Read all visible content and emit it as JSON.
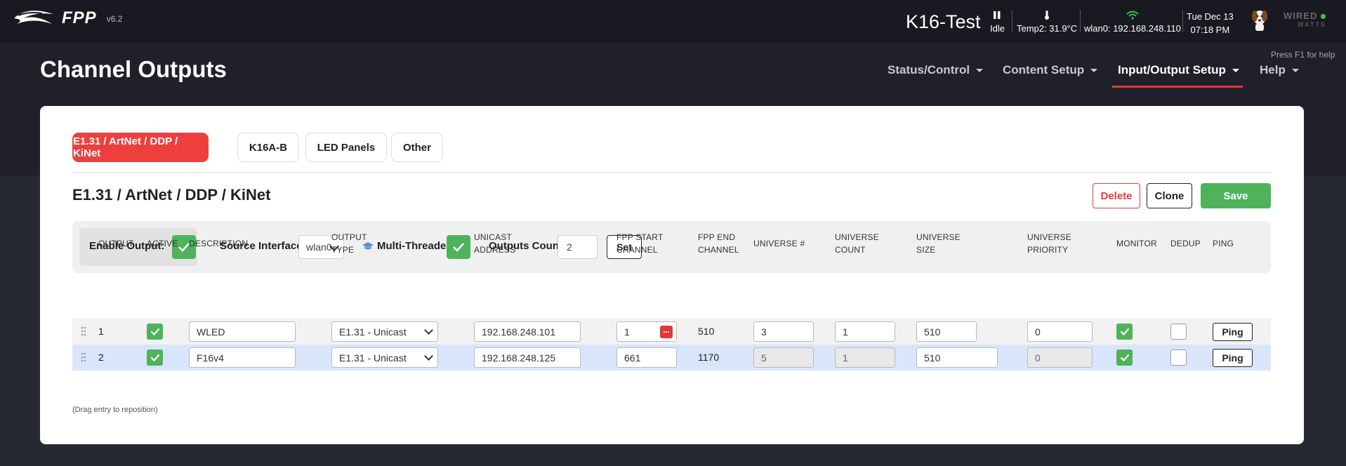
{
  "header": {
    "logo_text": "FPP",
    "version": "v6.2",
    "hostname": "K16-Test",
    "status": [
      {
        "icon": "pause-icon",
        "label": "Idle"
      },
      {
        "icon": "thermometer-icon",
        "label": "Temp2: 31.9°C"
      },
      {
        "icon": "wifi-icon",
        "label": "wlan0: 192.168.248.110"
      }
    ],
    "date": "Tue Dec 13",
    "time": "07:18 PM",
    "brand_top": "WIRED",
    "brand_bottom": "WATTS"
  },
  "page": {
    "title": "Channel Outputs",
    "help_hint": "Press F1 for help"
  },
  "nav": [
    {
      "label": "Status/Control",
      "active": false
    },
    {
      "label": "Content Setup",
      "active": false
    },
    {
      "label": "Input/Output Setup",
      "active": true
    },
    {
      "label": "Help",
      "active": false
    }
  ],
  "tabs": [
    {
      "label": "E1.31 / ArtNet / DDP / KiNet",
      "active": true
    },
    {
      "label": "K16A-B",
      "active": false
    },
    {
      "label": "LED Panels",
      "active": false
    },
    {
      "label": "Other",
      "active": false
    }
  ],
  "section": {
    "title": "E1.31 / ArtNet / DDP / KiNet",
    "delete_label": "Delete",
    "clone_label": "Clone",
    "save_label": "Save"
  },
  "settings": {
    "enable_label": "Enable Output:",
    "enable_checked": true,
    "source_label": "Source Interface:",
    "source_value": "wlan0",
    "multithread_label": "Multi-Threaded:",
    "multithread_checked": true,
    "count_label": "Outputs Count:",
    "count_value": "2",
    "set_label": "Set"
  },
  "table": {
    "headers": {
      "output": "OUTPUT",
      "active": "ACTIVE",
      "description": "DESCRIPTION",
      "output_type_1": "OUTPUT",
      "output_type_2": "TYPE",
      "unicast_1": "UNICAST",
      "unicast_2": "ADDRESS",
      "start_1": "FPP START",
      "start_2": "CHANNEL",
      "end_1": "FPP END",
      "end_2": "CHANNEL",
      "universe": "UNIVERSE #",
      "ucount_1": "UNIVERSE",
      "ucount_2": "COUNT",
      "usize_1": "UNIVERSE",
      "usize_2": "SIZE",
      "upriority_1": "UNIVERSE",
      "upriority_2": "PRIORITY",
      "monitor": "MONITOR",
      "dedup": "DEDUP",
      "ping": "PING"
    },
    "rows": [
      {
        "output": "1",
        "active": true,
        "description": "WLED",
        "type": "E1.31 - Unicast",
        "address": "192.168.248.101",
        "start": "1",
        "end": "510",
        "universe": "3",
        "ucount": "1",
        "usize": "510",
        "priority": "0",
        "monitor": true,
        "dedup": false,
        "ping": "Ping"
      },
      {
        "output": "2",
        "active": true,
        "description": "F16v4",
        "type": "E1.31 - Unicast",
        "address": "192.168.248.125",
        "start": "661",
        "end": "1170",
        "universe": "5",
        "ucount": "1",
        "usize": "510",
        "priority": "0",
        "monitor": true,
        "dedup": false,
        "ping": "Ping"
      }
    ],
    "note": "(Drag entry to reposition)"
  },
  "colors": {
    "accent_red": "#ee3f3f",
    "success_green": "#4fb35b",
    "header_bg": "#191a21",
    "row_highlight": "#d9e5fa"
  }
}
